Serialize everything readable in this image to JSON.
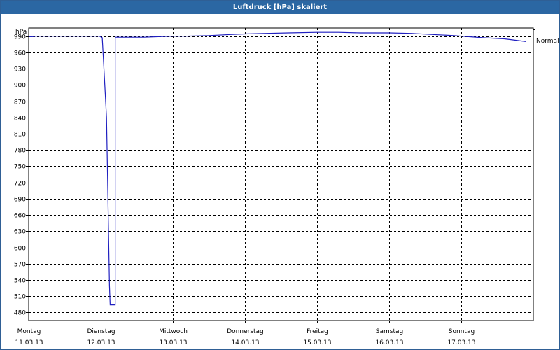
{
  "window": {
    "title": "Luftdruck [hPa] skaliert"
  },
  "chart_data": {
    "type": "line",
    "title": "Luftdruck [hPa] skaliert",
    "ylabel": "hPa",
    "xlabel": "",
    "ylim": [
      465,
      1005
    ],
    "yticks": [
      480,
      510,
      540,
      570,
      600,
      630,
      660,
      690,
      720,
      750,
      780,
      810,
      840,
      870,
      900,
      930,
      960,
      990
    ],
    "xticks": [
      {
        "day": "Montag",
        "date": "11.03.13"
      },
      {
        "day": "Dienstag",
        "date": "12.03.13"
      },
      {
        "day": "Mittwoch",
        "date": "13.03.13"
      },
      {
        "day": "Donnerstag",
        "date": "14.03.13"
      },
      {
        "day": "Freitag",
        "date": "15.03.13"
      },
      {
        "day": "Samstag",
        "date": "16.03.13"
      },
      {
        "day": "Sonntag",
        "date": "17.03.13"
      }
    ],
    "grid": true,
    "legend": "right",
    "series": [
      {
        "name": "Normal",
        "color": "#1f1fc0",
        "x": [
          0,
          0.05,
          0.1,
          0.2,
          0.3,
          0.4,
          0.5,
          0.6,
          0.7,
          0.8,
          0.9,
          0.98,
          1.02,
          1.04,
          1.08,
          1.12,
          1.13,
          1.15,
          1.17,
          1.2,
          1.2,
          1.4,
          1.6,
          1.8,
          2.0,
          2.2,
          2.5,
          2.8,
          3.0,
          3.3,
          3.6,
          4.0,
          4.3,
          4.6,
          5.0,
          5.3,
          5.6,
          5.9,
          6.1,
          6.3,
          6.6,
          6.9
        ],
        "y": [
          989,
          989,
          990,
          990,
          990,
          990,
          990,
          990,
          990,
          990,
          990,
          990,
          987,
          940,
          840,
          530,
          494,
          494,
          494,
          494,
          988,
          988,
          988,
          989,
          990,
          990,
          991,
          993,
          994,
          995,
          996,
          997,
          997,
          996,
          996,
          995,
          993,
          991,
          989,
          987,
          985,
          980
        ]
      }
    ]
  }
}
